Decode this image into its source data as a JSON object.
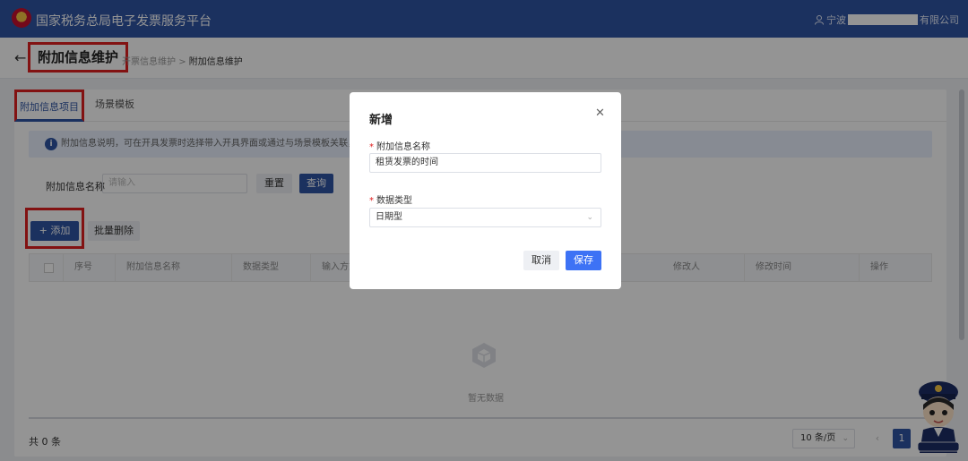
{
  "app": {
    "title": "国家税务总局电子发票服务平台"
  },
  "user": {
    "prefix": "宁波",
    "suffix": "有限公司"
  },
  "header": {
    "title": "附加信息维护",
    "breadcrumb": {
      "parent": "开票信息维护",
      "separator": ">",
      "current": "附加信息维护"
    }
  },
  "tabs": [
    {
      "label": "附加信息项目",
      "active": true
    },
    {
      "label": "场景模板",
      "active": false
    }
  ],
  "info_banner": "附加信息说明，可在开具发票时选择带入开具界面或通过与场景模板关联，通",
  "filter": {
    "label": "附加信息名称",
    "placeholder": "请输入",
    "reset": "重置",
    "query": "查询"
  },
  "toolbar": {
    "add": "+ 添加",
    "batch_delete": "批量删除"
  },
  "table": {
    "columns": [
      "序号",
      "附加信息名称",
      "数据类型",
      "输入方式",
      "修改人",
      "修改时间",
      "操作"
    ],
    "empty_text": "暂无数据"
  },
  "pagination": {
    "total": "共 0 条",
    "page_size": "10 条/页",
    "current": "1"
  },
  "modal": {
    "title": "新增",
    "name_label": "附加信息名称",
    "name_value": "租赁发票的时间",
    "type_label": "数据类型",
    "type_value": "日期型",
    "cancel": "取消",
    "save": "保存"
  }
}
